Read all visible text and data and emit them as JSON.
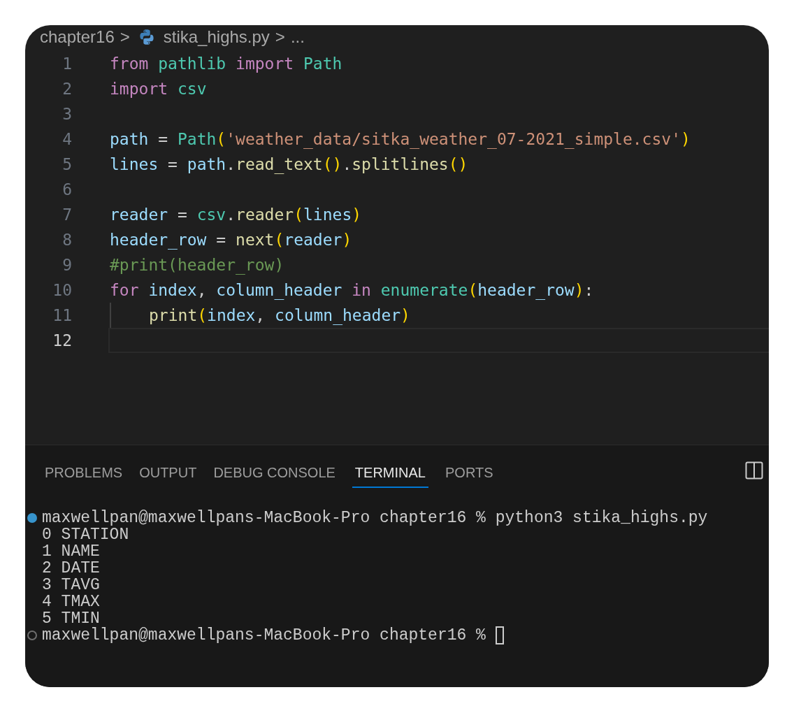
{
  "breadcrumb": {
    "folder": "chapter16",
    "separator_1": ">",
    "file": "stika_highs.py",
    "separator_2": ">",
    "more": "..."
  },
  "code_lines": [
    {
      "number": "1",
      "current": false,
      "tokens": [
        {
          "text": "from ",
          "kind": "keyword"
        },
        {
          "text": "pathlib ",
          "kind": "module"
        },
        {
          "text": "import ",
          "kind": "keyword"
        },
        {
          "text": "Path",
          "kind": "module"
        }
      ]
    },
    {
      "number": "2",
      "current": false,
      "tokens": [
        {
          "text": "import ",
          "kind": "keyword"
        },
        {
          "text": "csv",
          "kind": "module"
        }
      ]
    },
    {
      "number": "3",
      "current": false
    },
    {
      "number": "4",
      "current": false,
      "tokens": [
        {
          "text": "path",
          "kind": "variable"
        },
        {
          "text": " = ",
          "kind": "plain"
        },
        {
          "text": "Path",
          "kind": "module"
        },
        {
          "text": "(",
          "kind": "bracket"
        },
        {
          "text": "'weather_data/sitka_weather_07-2021_simple.csv'",
          "kind": "string"
        },
        {
          "text": ")",
          "kind": "bracket"
        }
      ]
    },
    {
      "number": "5",
      "current": false,
      "tokens": [
        {
          "text": "lines",
          "kind": "variable"
        },
        {
          "text": " = ",
          "kind": "plain"
        },
        {
          "text": "path",
          "kind": "variable"
        },
        {
          "text": ".",
          "kind": "plain"
        },
        {
          "text": "read_text",
          "kind": "function"
        },
        {
          "text": "()",
          "kind": "bracket"
        },
        {
          "text": ".",
          "kind": "plain"
        },
        {
          "text": "splitlines",
          "kind": "function"
        },
        {
          "text": "()",
          "kind": "bracket"
        }
      ]
    },
    {
      "number": "6",
      "current": false
    },
    {
      "number": "7",
      "current": false,
      "tokens": [
        {
          "text": "reader",
          "kind": "variable"
        },
        {
          "text": " = ",
          "kind": "plain"
        },
        {
          "text": "csv",
          "kind": "module"
        },
        {
          "text": ".",
          "kind": "plain"
        },
        {
          "text": "reader",
          "kind": "function"
        },
        {
          "text": "(",
          "kind": "bracket"
        },
        {
          "text": "lines",
          "kind": "variable"
        },
        {
          "text": ")",
          "kind": "bracket"
        }
      ]
    },
    {
      "number": "8",
      "current": false,
      "tokens": [
        {
          "text": "header_row",
          "kind": "variable"
        },
        {
          "text": " = ",
          "kind": "plain"
        },
        {
          "text": "next",
          "kind": "function"
        },
        {
          "text": "(",
          "kind": "bracket"
        },
        {
          "text": "reader",
          "kind": "variable"
        },
        {
          "text": ")",
          "kind": "bracket"
        }
      ]
    },
    {
      "number": "9",
      "current": false,
      "tokens": [
        {
          "text": "#print(header_row)",
          "kind": "comment"
        }
      ]
    },
    {
      "number": "10",
      "current": false,
      "tokens": [
        {
          "text": "for ",
          "kind": "keyword"
        },
        {
          "text": "index",
          "kind": "variable"
        },
        {
          "text": ", ",
          "kind": "plain"
        },
        {
          "text": "column_header",
          "kind": "variable"
        },
        {
          "text": " in ",
          "kind": "keyword"
        },
        {
          "text": "enumerate",
          "kind": "module"
        },
        {
          "text": "(",
          "kind": "bracket"
        },
        {
          "text": "header_row",
          "kind": "variable"
        },
        {
          "text": ")",
          "kind": "bracket"
        },
        {
          "text": ":",
          "kind": "plain"
        }
      ]
    },
    {
      "number": "11",
      "current": false,
      "indent_guide": true,
      "tokens": [
        {
          "text": "print",
          "kind": "function"
        },
        {
          "text": "(",
          "kind": "bracket"
        },
        {
          "text": "index",
          "kind": "variable"
        },
        {
          "text": ", ",
          "kind": "plain"
        },
        {
          "text": "column_header",
          "kind": "variable"
        },
        {
          "text": ")",
          "kind": "bracket"
        }
      ]
    },
    {
      "number": "12",
      "current": true
    }
  ],
  "panel_tabs": [
    {
      "label": "PROBLEMS",
      "selected": false
    },
    {
      "label": "OUTPUT",
      "selected": false
    },
    {
      "label": "DEBUG CONSOLE",
      "selected": false
    },
    {
      "label": "TERMINAL",
      "selected": true
    },
    {
      "label": "PORTS",
      "selected": false
    }
  ],
  "terminal_lines": [
    {
      "kind": "prompt",
      "completed": true,
      "cursor": false,
      "text": "maxwellpan@maxwellpans-MacBook-Pro chapter16 % python3 stika_highs.py"
    },
    {
      "kind": "output",
      "text": "0 STATION"
    },
    {
      "kind": "output",
      "text": "1 NAME"
    },
    {
      "kind": "output",
      "text": "2 DATE"
    },
    {
      "kind": "output",
      "text": "3 TAVG"
    },
    {
      "kind": "output",
      "text": "4 TMAX"
    },
    {
      "kind": "output",
      "text": "5 TMIN"
    },
    {
      "kind": "prompt",
      "completed": false,
      "cursor": true,
      "text": "maxwellpan@maxwellpans-MacBook-Pro chapter16 %"
    }
  ]
}
